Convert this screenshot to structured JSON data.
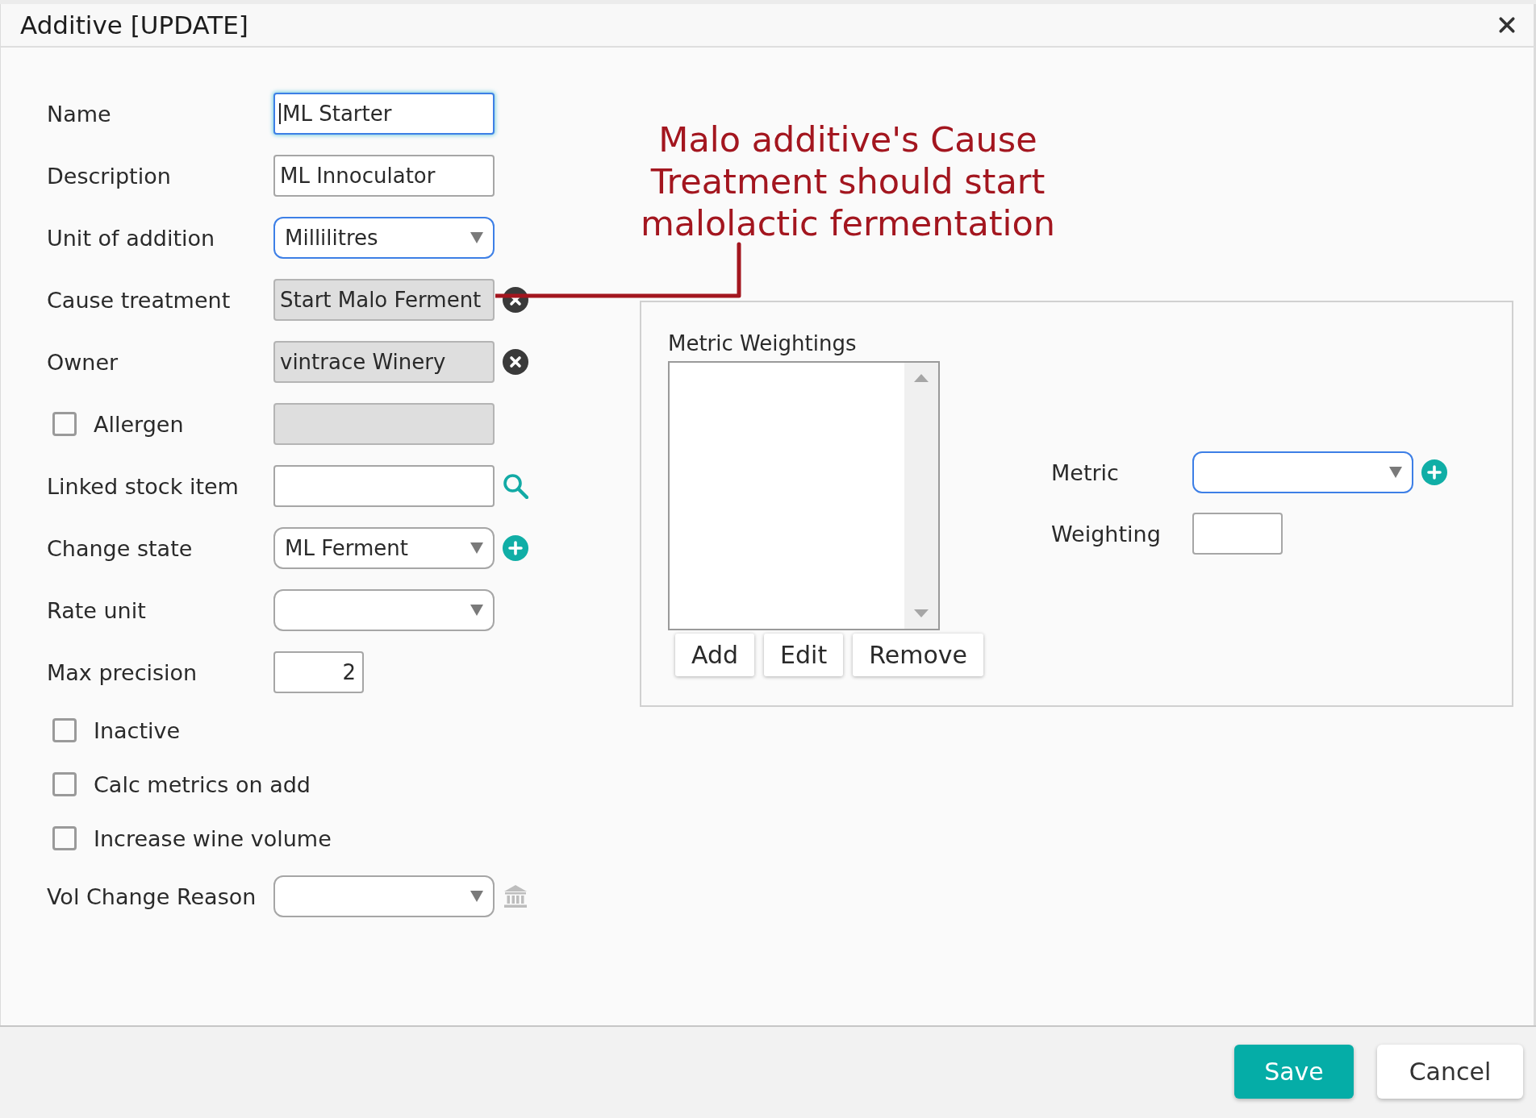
{
  "dialog": {
    "title": "Additive [UPDATE]"
  },
  "form": {
    "rows": [
      {
        "kind": "field",
        "label": "Name",
        "input": {
          "kind": "text",
          "value": "ML Starter",
          "focused": true,
          "highlighted": true,
          "disabled": false
        }
      },
      {
        "kind": "field",
        "label": "Description",
        "input": {
          "kind": "text",
          "value": "ML Innoculator",
          "focused": false,
          "highlighted": false,
          "disabled": false
        }
      },
      {
        "kind": "field",
        "label": "Unit of addition",
        "input": {
          "kind": "select",
          "value": "Millilitres",
          "focused": false,
          "highlighted": true,
          "disabled": false
        }
      },
      {
        "kind": "field",
        "label": "Cause treatment",
        "input": {
          "kind": "text",
          "value": "Start Malo Ferment",
          "focused": false,
          "highlighted": false,
          "disabled": true
        },
        "action": {
          "kind": "clear",
          "disabled": false
        }
      },
      {
        "kind": "field",
        "label": "Owner",
        "input": {
          "kind": "text",
          "value": "vintrace Winery",
          "focused": false,
          "highlighted": false,
          "disabled": true
        },
        "action": {
          "kind": "clear",
          "disabled": false
        }
      },
      {
        "kind": "checkbox",
        "label": "Allergen",
        "checked": false,
        "input": {
          "kind": "text",
          "focused": false,
          "highlighted": false,
          "disabled": true
        }
      },
      {
        "kind": "field",
        "label": "Linked stock item",
        "input": {
          "kind": "text",
          "focused": false,
          "highlighted": false,
          "disabled": false
        },
        "action": {
          "kind": "search",
          "disabled": false
        }
      },
      {
        "kind": "field",
        "label": "Change state",
        "input": {
          "kind": "select",
          "value": "ML Ferment",
          "focused": false,
          "highlighted": false,
          "disabled": false
        },
        "action": {
          "kind": "add",
          "disabled": false
        }
      },
      {
        "kind": "field",
        "label": "Rate unit",
        "input": {
          "kind": "select",
          "focused": false,
          "highlighted": false,
          "disabled": false
        }
      },
      {
        "kind": "field",
        "label": "Max precision",
        "input": {
          "kind": "number",
          "value": "2",
          "focused": false,
          "highlighted": false,
          "disabled": false
        }
      },
      {
        "kind": "checkbox",
        "label": "Inactive",
        "checked": false
      },
      {
        "kind": "checkbox",
        "label": "Calc metrics on add",
        "checked": false
      },
      {
        "kind": "checkbox",
        "label": "Increase wine volume",
        "checked": false
      },
      {
        "kind": "field",
        "label": "Vol Change Reason",
        "input": {
          "kind": "select",
          "focused": false,
          "highlighted": false,
          "disabled": false
        },
        "action": {
          "kind": "bank",
          "disabled": true
        }
      }
    ]
  },
  "annotation": {
    "text": "Malo additive's Cause Treatment should start malolactic fermentation"
  },
  "metric_weightings": {
    "title": "Metric Weightings",
    "buttons": [
      "Add",
      "Edit",
      "Remove"
    ],
    "fields": [
      {
        "label": "Metric",
        "kind": "select",
        "focused": false,
        "highlighted": true,
        "disabled": false,
        "action": {
          "kind": "add",
          "disabled": false
        }
      },
      {
        "label": "Weighting",
        "kind": "number",
        "focused": false,
        "highlighted": false,
        "disabled": false
      }
    ]
  },
  "footer": {
    "buttons": [
      {
        "label": "Save",
        "kind": "primary"
      },
      {
        "label": "Cancel",
        "kind": "secondary"
      }
    ]
  }
}
